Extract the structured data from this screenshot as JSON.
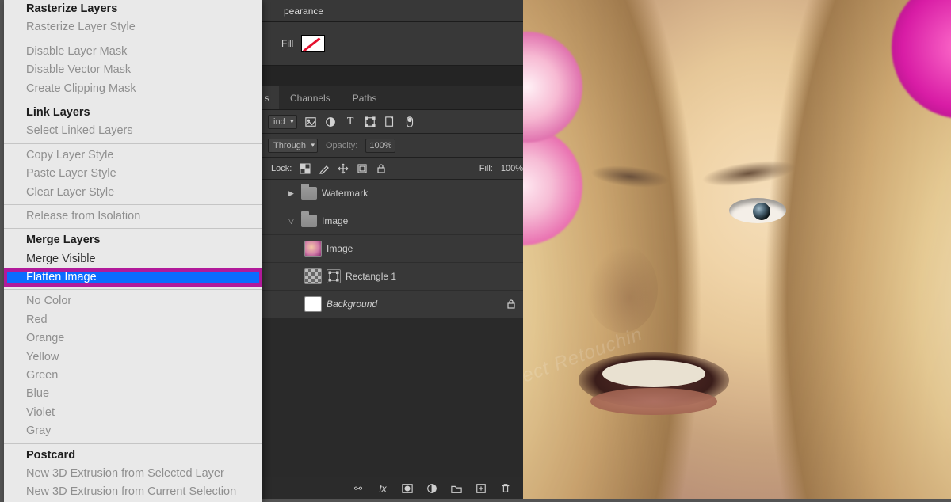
{
  "canvas_watermark": "ect Retouchin",
  "panels": {
    "header_tab": "pearance",
    "fill_label": "Fill",
    "tabs": {
      "layers_stub": "s",
      "channels": "Channels",
      "paths": "Paths"
    },
    "opt_row1": {
      "kind_stub": "ind",
      "icons": [
        "image-filter-icon",
        "adjustment-icon",
        "type-icon",
        "shape-icon",
        "smartobj-icon",
        "toggle-icon"
      ]
    },
    "opt_row2": {
      "blend_mode": "Through",
      "opacity_label": "Opacity:",
      "opacity_value": "100%"
    },
    "lock_row": {
      "label": "Lock:",
      "fill_label": "Fill:",
      "fill_value": "100%"
    },
    "layers": [
      {
        "type": "group",
        "expanded": false,
        "name": "Watermark"
      },
      {
        "type": "group",
        "expanded": true,
        "name": "Image"
      },
      {
        "type": "image",
        "indent": 2,
        "name": "Image"
      },
      {
        "type": "shape",
        "indent": 2,
        "name": "Rectangle 1"
      },
      {
        "type": "bg",
        "indent": 2,
        "name": "Background",
        "locked": true
      }
    ],
    "bottom_icons": [
      "link",
      "fx",
      "mask",
      "adjust",
      "group",
      "new",
      "trash"
    ]
  },
  "context_menu": {
    "groups": [
      [
        {
          "label": "Rasterize Layers",
          "state": "bold"
        },
        {
          "label": "Rasterize Layer Style",
          "state": "disabled"
        }
      ],
      [
        {
          "label": "Disable Layer Mask",
          "state": "disabled"
        },
        {
          "label": "Disable Vector Mask",
          "state": "disabled"
        },
        {
          "label": "Create Clipping Mask",
          "state": "disabled"
        }
      ],
      [
        {
          "label": "Link Layers",
          "state": "bold"
        },
        {
          "label": "Select Linked Layers",
          "state": "disabled"
        }
      ],
      [
        {
          "label": "Copy Layer Style",
          "state": "disabled"
        },
        {
          "label": "Paste Layer Style",
          "state": "disabled"
        },
        {
          "label": "Clear Layer Style",
          "state": "disabled"
        }
      ],
      [
        {
          "label": "Release from Isolation",
          "state": "disabled"
        }
      ],
      [
        {
          "label": "Merge Layers",
          "state": "bold"
        },
        {
          "label": "Merge Visible",
          "state": "normal"
        },
        {
          "label": "Flatten Image",
          "state": "selected"
        }
      ],
      [
        {
          "label": "No Color",
          "state": "disabled"
        },
        {
          "label": "Red",
          "state": "disabled"
        },
        {
          "label": "Orange",
          "state": "disabled"
        },
        {
          "label": "Yellow",
          "state": "disabled"
        },
        {
          "label": "Green",
          "state": "disabled"
        },
        {
          "label": "Blue",
          "state": "disabled"
        },
        {
          "label": "Violet",
          "state": "disabled"
        },
        {
          "label": "Gray",
          "state": "disabled"
        }
      ],
      [
        {
          "label": "Postcard",
          "state": "bold"
        },
        {
          "label": "New 3D Extrusion from Selected Layer",
          "state": "disabled"
        },
        {
          "label": "New 3D Extrusion from Current Selection",
          "state": "disabled"
        }
      ]
    ]
  }
}
